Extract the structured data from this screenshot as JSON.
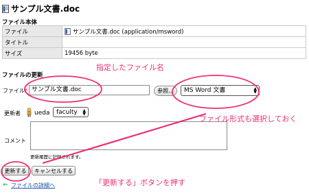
{
  "header": {
    "title": "サンプル文書.doc"
  },
  "file_body": {
    "section_label": "ファイル本体",
    "rows": [
      {
        "label": "ファイル",
        "value": "サンプル文書.doc (application/msword)"
      },
      {
        "label": "タイトル",
        "value": ""
      },
      {
        "label": "サイズ",
        "value": "19456 byte"
      }
    ]
  },
  "update": {
    "section_label": "ファイルの更新",
    "file_label": "ファイル",
    "required_mark": "*",
    "file_value": "サンプル文書.doc",
    "browse_button": "参照...",
    "format_value": "MS Word 文書",
    "updater_label": "更新者",
    "updater_name": "ueda",
    "group_value": "faculty",
    "comment_label": "コメント",
    "comment_value": "",
    "history_note": "更新履歴に記録されます。",
    "update_button": "更新する",
    "cancel_button": "キャンセルする",
    "detail_link": "ファイルの詳細へ",
    "back_icon": "arrow-left-icon"
  },
  "annotations": {
    "filename": "指定したファイル名",
    "format": "ファイル形式も選択しておく",
    "update_button": "「更新する」ボタンを押す"
  },
  "colors": {
    "annotation": "#ee2f74",
    "link": "#1a4ca8",
    "label_bg": "#e8e8e8"
  }
}
